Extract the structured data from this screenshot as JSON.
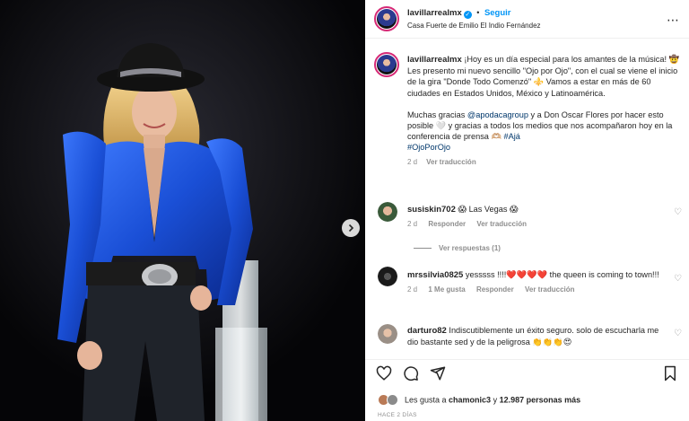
{
  "header": {
    "username": "lavillarrealmx",
    "verified_mark": "✓",
    "separator": "•",
    "follow_label": "Seguir",
    "location": "Casa Fuerte de Emilio El Indio Fernández",
    "more_icon": "⋯"
  },
  "caption": {
    "username": "lavillarrealmx",
    "paragraph1": "¡Hoy es un día especial para los amantes de la música! 🤠 Les presento mi nuevo sencillo \"Ojo por Ojo\", con el cual se viene el inicio de la gira \"Donde Todo Comenzó\" ⚜️ Vamos a estar en más de 60 ciudades en Estados Unidos, México y Latinoamérica.",
    "paragraph2_a": "Muchas gracias ",
    "mention": "@apodacagroup",
    "paragraph2_b": " y a Don Oscar Flores por hacer esto posible 🤍 y gracias a todos los medios que nos acompañaron hoy en la conferencia de prensa 🫶🏼 ",
    "hashtag1": "#Ajá",
    "hashtag2": "#OjoPorOjo",
    "time": "2 d",
    "translation": "Ver traducción"
  },
  "comments": [
    {
      "username": "susiskin702",
      "text": "😱 Las Vegas 😱",
      "time": "2 d",
      "reply": "Responder",
      "translation": "Ver traducción",
      "replies_label": "Ver respuestas (1)"
    },
    {
      "username": "mrssilvia0825",
      "text": "yesssss !!!!❤️❤️❤️❤️ the queen is coming to town!!!",
      "time": "2 d",
      "likes": "1 Me gusta",
      "reply": "Responder",
      "translation": "Ver traducción"
    },
    {
      "username": "darturo82",
      "text": "Indiscutiblemente un éxito seguro. solo de escucharla me dio bastante sed y de la peligrosa 👏👏👏😍"
    }
  ],
  "footer": {
    "likes_prefix": "Les gusta a ",
    "likes_user": "chamonic3",
    "likes_middle": " y ",
    "likes_count": "12.987 personas más",
    "time_ago": "HACE 2 DÍAS"
  },
  "icons": [
    "heart-icon",
    "comment-icon",
    "share-icon",
    "bookmark-icon",
    "chevron-right-icon",
    "verified-icon",
    "more-icon"
  ],
  "colors": {
    "accent": "#0095f6",
    "jacket": "#1a4fd6",
    "background_media": "#000000"
  }
}
